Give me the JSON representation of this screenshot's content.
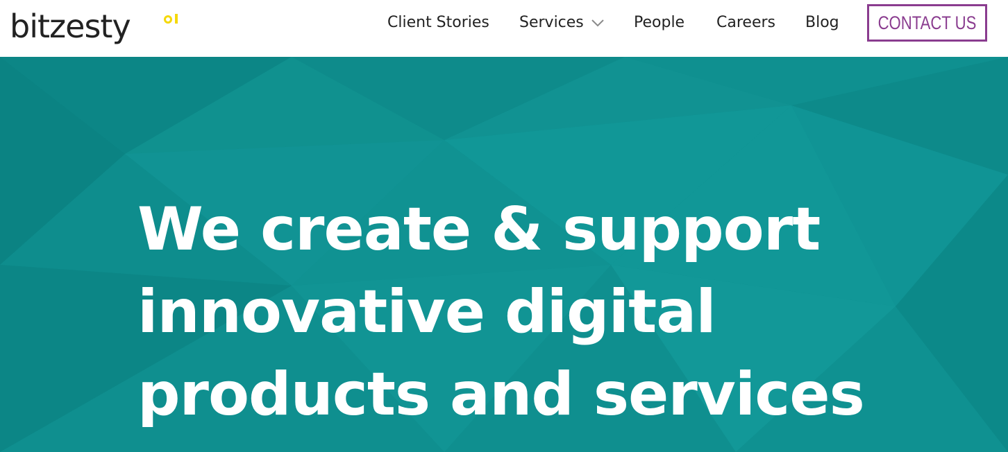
{
  "brand": {
    "name": "bitzesty",
    "accent_color": "#f5d90a"
  },
  "nav": {
    "items": [
      {
        "label": "Client Stories"
      },
      {
        "label": "Services",
        "has_dropdown": true
      },
      {
        "label": "People"
      },
      {
        "label": "Careers"
      },
      {
        "label": "Blog"
      }
    ],
    "contact_label": "CONTACT US",
    "contact_color": "#8a3c8f"
  },
  "hero": {
    "background_color": "#0f8f8f",
    "headline_lines": [
      "We create & support",
      "innovative digital",
      "products and services"
    ]
  }
}
